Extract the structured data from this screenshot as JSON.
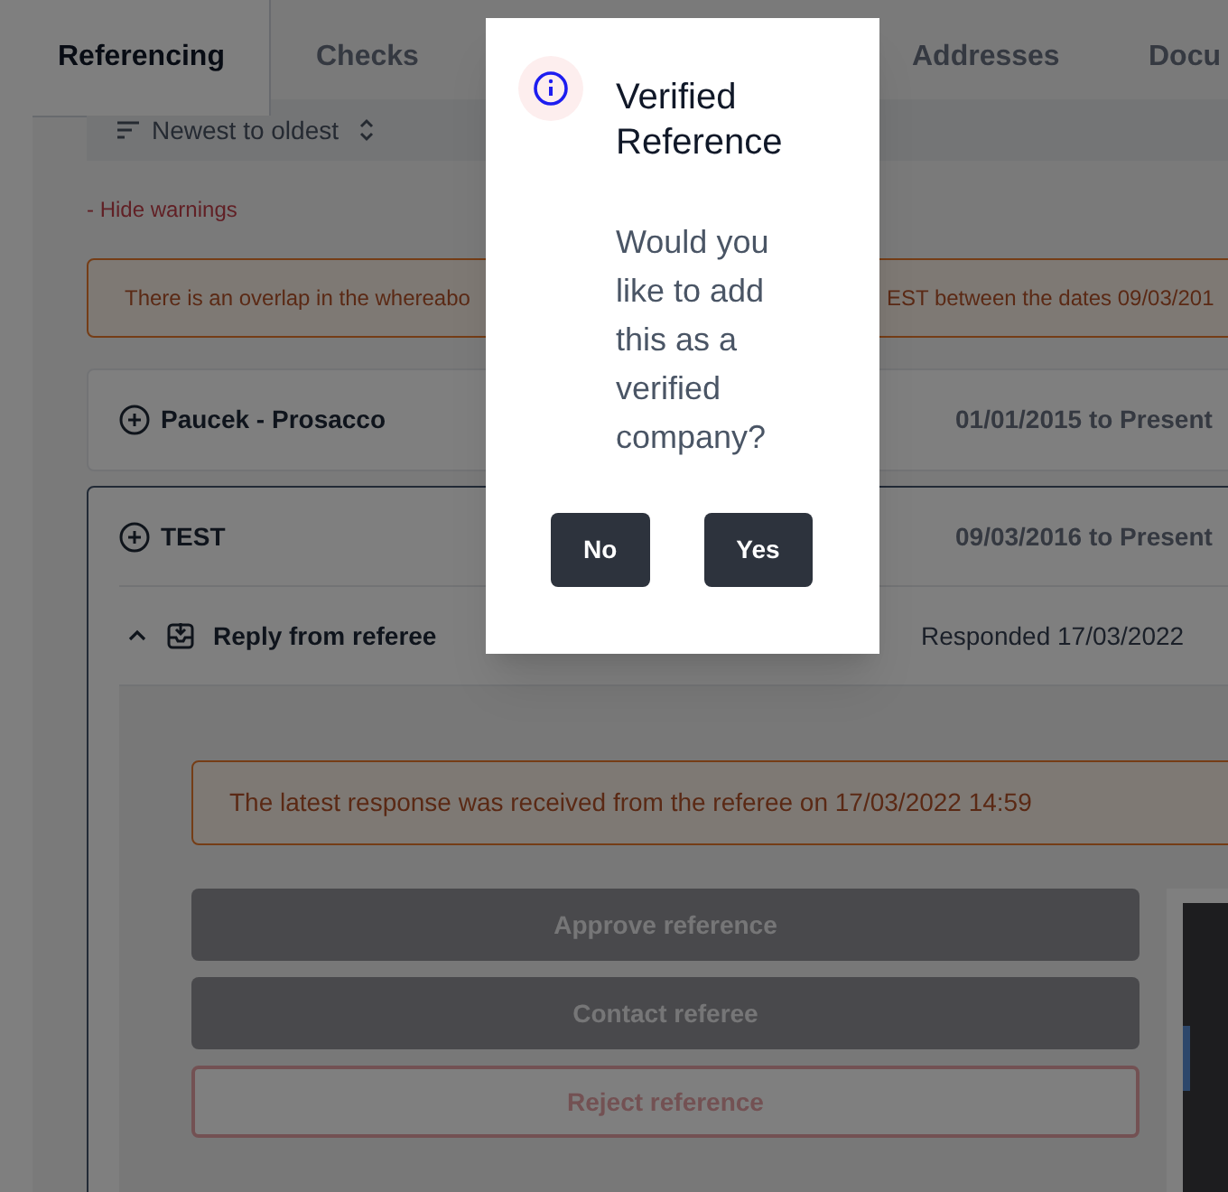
{
  "tabs": [
    {
      "label": "Referencing",
      "selected": true
    },
    {
      "label": "Checks",
      "selected": false
    },
    {
      "label": "Addresses",
      "selected": false
    },
    {
      "label": "Docu",
      "selected": false
    }
  ],
  "sort": {
    "label": "Newest to oldest"
  },
  "warnings_toggle": "- Hide warnings",
  "warning": {
    "text_start": "There is an overlap in the whereabo",
    "text_end": "EST between the dates 09/03/201"
  },
  "references": [
    {
      "name": "Paucek - Prosacco",
      "dates": "01/01/2015 to Present",
      "expanded": false
    },
    {
      "name": "TEST",
      "dates": "09/03/2016 to Present",
      "expanded": true,
      "sections": [
        {
          "title": "Reply from referee",
          "status": "Responded 17/03/2022",
          "expanded": true,
          "notice": "The latest response was received from the referee on 17/03/2022 14:59",
          "actions": [
            {
              "label": "Approve reference",
              "kind": "filled",
              "disabled": true
            },
            {
              "label": "Contact referee",
              "kind": "filled",
              "disabled": true
            },
            {
              "label": "Reject reference",
              "kind": "outline",
              "disabled": true
            }
          ]
        }
      ]
    }
  ],
  "dialog": {
    "title": "Verified Reference",
    "message": "Would you like to add this as a verified company?",
    "buttons": [
      "No",
      "Yes"
    ]
  }
}
